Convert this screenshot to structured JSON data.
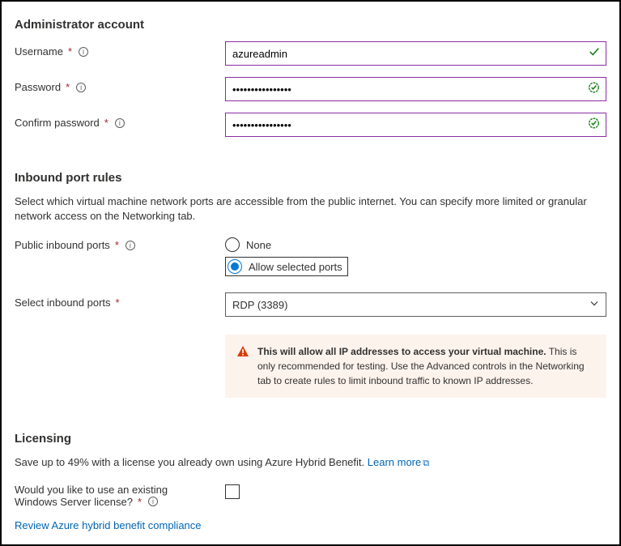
{
  "admin": {
    "title": "Administrator account",
    "username_label": "Username",
    "username_value": "azureadmin",
    "password_label": "Password",
    "password_value": "••••••••••••••••",
    "confirm_label": "Confirm password",
    "confirm_value": "••••••••••••••••"
  },
  "ports": {
    "title": "Inbound port rules",
    "desc": "Select which virtual machine network ports are accessible from the public internet. You can specify more limited or granular network access on the Networking tab.",
    "public_label": "Public inbound ports",
    "option_none": "None",
    "option_allow": "Allow selected ports",
    "select_label": "Select inbound ports",
    "select_value": "RDP (3389)",
    "warning_bold": "This will allow all IP addresses to access your virtual machine.",
    "warning_rest": " This is only recommended for testing.  Use the Advanced controls in the Networking tab to create rules to limit inbound traffic to known IP addresses."
  },
  "licensing": {
    "title": "Licensing",
    "desc_pre": "Save up to 49% with a license you already own using Azure Hybrid Benefit.  ",
    "learn_more": "Learn more",
    "existing_label_1": "Would you like to use an existing",
    "existing_label_2": "Windows Server license?",
    "review_link": "Review Azure hybrid benefit compliance"
  }
}
